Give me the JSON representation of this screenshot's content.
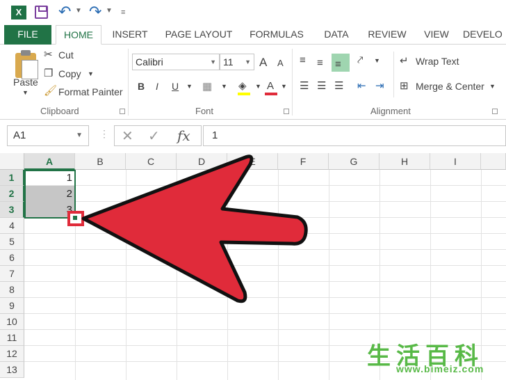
{
  "quick_access": {
    "app_icon": "X",
    "icons": [
      "excel-logo-icon",
      "save-icon",
      "undo-icon",
      "redo-icon",
      "customize-icon"
    ]
  },
  "tabs": [
    "FILE",
    "HOME",
    "INSERT",
    "PAGE LAYOUT",
    "FORMULAS",
    "DATA",
    "REVIEW",
    "VIEW",
    "DEVELO"
  ],
  "active_tab": "HOME",
  "ribbon": {
    "clipboard": {
      "paste": "Paste",
      "cut": "Cut",
      "copy": "Copy",
      "format_painter": "Format Painter",
      "label": "Clipboard"
    },
    "font": {
      "name": "Calibri",
      "size": "11",
      "grow": "A",
      "shrink": "A",
      "bold": "B",
      "italic": "I",
      "underline": "U",
      "font_color": "A",
      "label": "Font"
    },
    "alignment": {
      "wrap_text": "Wrap Text",
      "merge_center": "Merge & Center",
      "label": "Alignment"
    }
  },
  "formula_bar": {
    "name_box": "A1",
    "fx": "fx",
    "value": "1"
  },
  "sheet": {
    "columns": [
      "A",
      "B",
      "C",
      "D",
      "E",
      "F",
      "G",
      "H",
      "I"
    ],
    "rows": [
      "1",
      "2",
      "3",
      "4",
      "5",
      "6",
      "7",
      "8",
      "9",
      "10",
      "11",
      "12",
      "13"
    ],
    "cells": [
      "1",
      "2",
      "3"
    ]
  },
  "colors": {
    "accent": "#217346",
    "arrow": "#e02b3a",
    "watermark": "#58b947"
  },
  "watermark": {
    "cn": "生活百科",
    "url": "www.bimeiz.com"
  }
}
